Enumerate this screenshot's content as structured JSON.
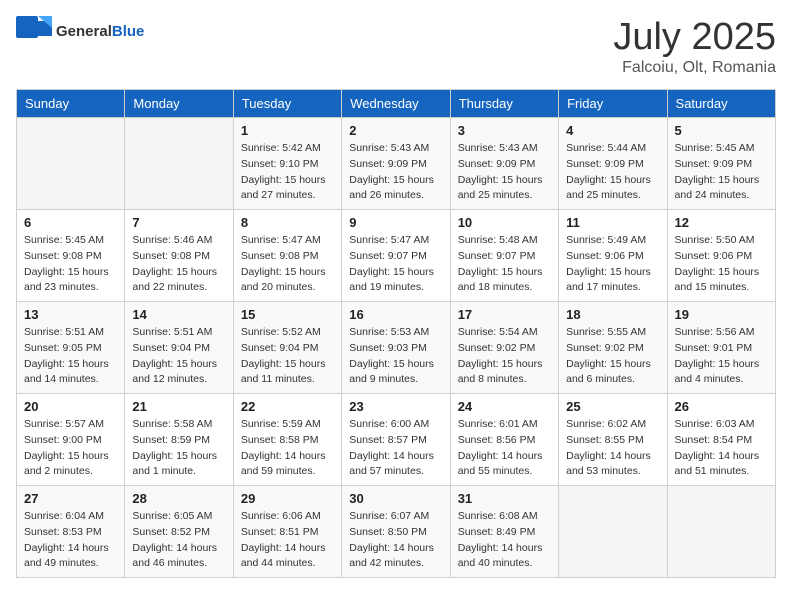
{
  "header": {
    "logo_general": "General",
    "logo_blue": "Blue",
    "title": "July 2025",
    "location": "Falcoiu, Olt, Romania"
  },
  "weekdays": [
    "Sunday",
    "Monday",
    "Tuesday",
    "Wednesday",
    "Thursday",
    "Friday",
    "Saturday"
  ],
  "weeks": [
    [
      {
        "day": "",
        "info": ""
      },
      {
        "day": "",
        "info": ""
      },
      {
        "day": "1",
        "info": "Sunrise: 5:42 AM\nSunset: 9:10 PM\nDaylight: 15 hours and 27 minutes."
      },
      {
        "day": "2",
        "info": "Sunrise: 5:43 AM\nSunset: 9:09 PM\nDaylight: 15 hours and 26 minutes."
      },
      {
        "day": "3",
        "info": "Sunrise: 5:43 AM\nSunset: 9:09 PM\nDaylight: 15 hours and 25 minutes."
      },
      {
        "day": "4",
        "info": "Sunrise: 5:44 AM\nSunset: 9:09 PM\nDaylight: 15 hours and 25 minutes."
      },
      {
        "day": "5",
        "info": "Sunrise: 5:45 AM\nSunset: 9:09 PM\nDaylight: 15 hours and 24 minutes."
      }
    ],
    [
      {
        "day": "6",
        "info": "Sunrise: 5:45 AM\nSunset: 9:08 PM\nDaylight: 15 hours and 23 minutes."
      },
      {
        "day": "7",
        "info": "Sunrise: 5:46 AM\nSunset: 9:08 PM\nDaylight: 15 hours and 22 minutes."
      },
      {
        "day": "8",
        "info": "Sunrise: 5:47 AM\nSunset: 9:08 PM\nDaylight: 15 hours and 20 minutes."
      },
      {
        "day": "9",
        "info": "Sunrise: 5:47 AM\nSunset: 9:07 PM\nDaylight: 15 hours and 19 minutes."
      },
      {
        "day": "10",
        "info": "Sunrise: 5:48 AM\nSunset: 9:07 PM\nDaylight: 15 hours and 18 minutes."
      },
      {
        "day": "11",
        "info": "Sunrise: 5:49 AM\nSunset: 9:06 PM\nDaylight: 15 hours and 17 minutes."
      },
      {
        "day": "12",
        "info": "Sunrise: 5:50 AM\nSunset: 9:06 PM\nDaylight: 15 hours and 15 minutes."
      }
    ],
    [
      {
        "day": "13",
        "info": "Sunrise: 5:51 AM\nSunset: 9:05 PM\nDaylight: 15 hours and 14 minutes."
      },
      {
        "day": "14",
        "info": "Sunrise: 5:51 AM\nSunset: 9:04 PM\nDaylight: 15 hours and 12 minutes."
      },
      {
        "day": "15",
        "info": "Sunrise: 5:52 AM\nSunset: 9:04 PM\nDaylight: 15 hours and 11 minutes."
      },
      {
        "day": "16",
        "info": "Sunrise: 5:53 AM\nSunset: 9:03 PM\nDaylight: 15 hours and 9 minutes."
      },
      {
        "day": "17",
        "info": "Sunrise: 5:54 AM\nSunset: 9:02 PM\nDaylight: 15 hours and 8 minutes."
      },
      {
        "day": "18",
        "info": "Sunrise: 5:55 AM\nSunset: 9:02 PM\nDaylight: 15 hours and 6 minutes."
      },
      {
        "day": "19",
        "info": "Sunrise: 5:56 AM\nSunset: 9:01 PM\nDaylight: 15 hours and 4 minutes."
      }
    ],
    [
      {
        "day": "20",
        "info": "Sunrise: 5:57 AM\nSunset: 9:00 PM\nDaylight: 15 hours and 2 minutes."
      },
      {
        "day": "21",
        "info": "Sunrise: 5:58 AM\nSunset: 8:59 PM\nDaylight: 15 hours and 1 minute."
      },
      {
        "day": "22",
        "info": "Sunrise: 5:59 AM\nSunset: 8:58 PM\nDaylight: 14 hours and 59 minutes."
      },
      {
        "day": "23",
        "info": "Sunrise: 6:00 AM\nSunset: 8:57 PM\nDaylight: 14 hours and 57 minutes."
      },
      {
        "day": "24",
        "info": "Sunrise: 6:01 AM\nSunset: 8:56 PM\nDaylight: 14 hours and 55 minutes."
      },
      {
        "day": "25",
        "info": "Sunrise: 6:02 AM\nSunset: 8:55 PM\nDaylight: 14 hours and 53 minutes."
      },
      {
        "day": "26",
        "info": "Sunrise: 6:03 AM\nSunset: 8:54 PM\nDaylight: 14 hours and 51 minutes."
      }
    ],
    [
      {
        "day": "27",
        "info": "Sunrise: 6:04 AM\nSunset: 8:53 PM\nDaylight: 14 hours and 49 minutes."
      },
      {
        "day": "28",
        "info": "Sunrise: 6:05 AM\nSunset: 8:52 PM\nDaylight: 14 hours and 46 minutes."
      },
      {
        "day": "29",
        "info": "Sunrise: 6:06 AM\nSunset: 8:51 PM\nDaylight: 14 hours and 44 minutes."
      },
      {
        "day": "30",
        "info": "Sunrise: 6:07 AM\nSunset: 8:50 PM\nDaylight: 14 hours and 42 minutes."
      },
      {
        "day": "31",
        "info": "Sunrise: 6:08 AM\nSunset: 8:49 PM\nDaylight: 14 hours and 40 minutes."
      },
      {
        "day": "",
        "info": ""
      },
      {
        "day": "",
        "info": ""
      }
    ]
  ]
}
